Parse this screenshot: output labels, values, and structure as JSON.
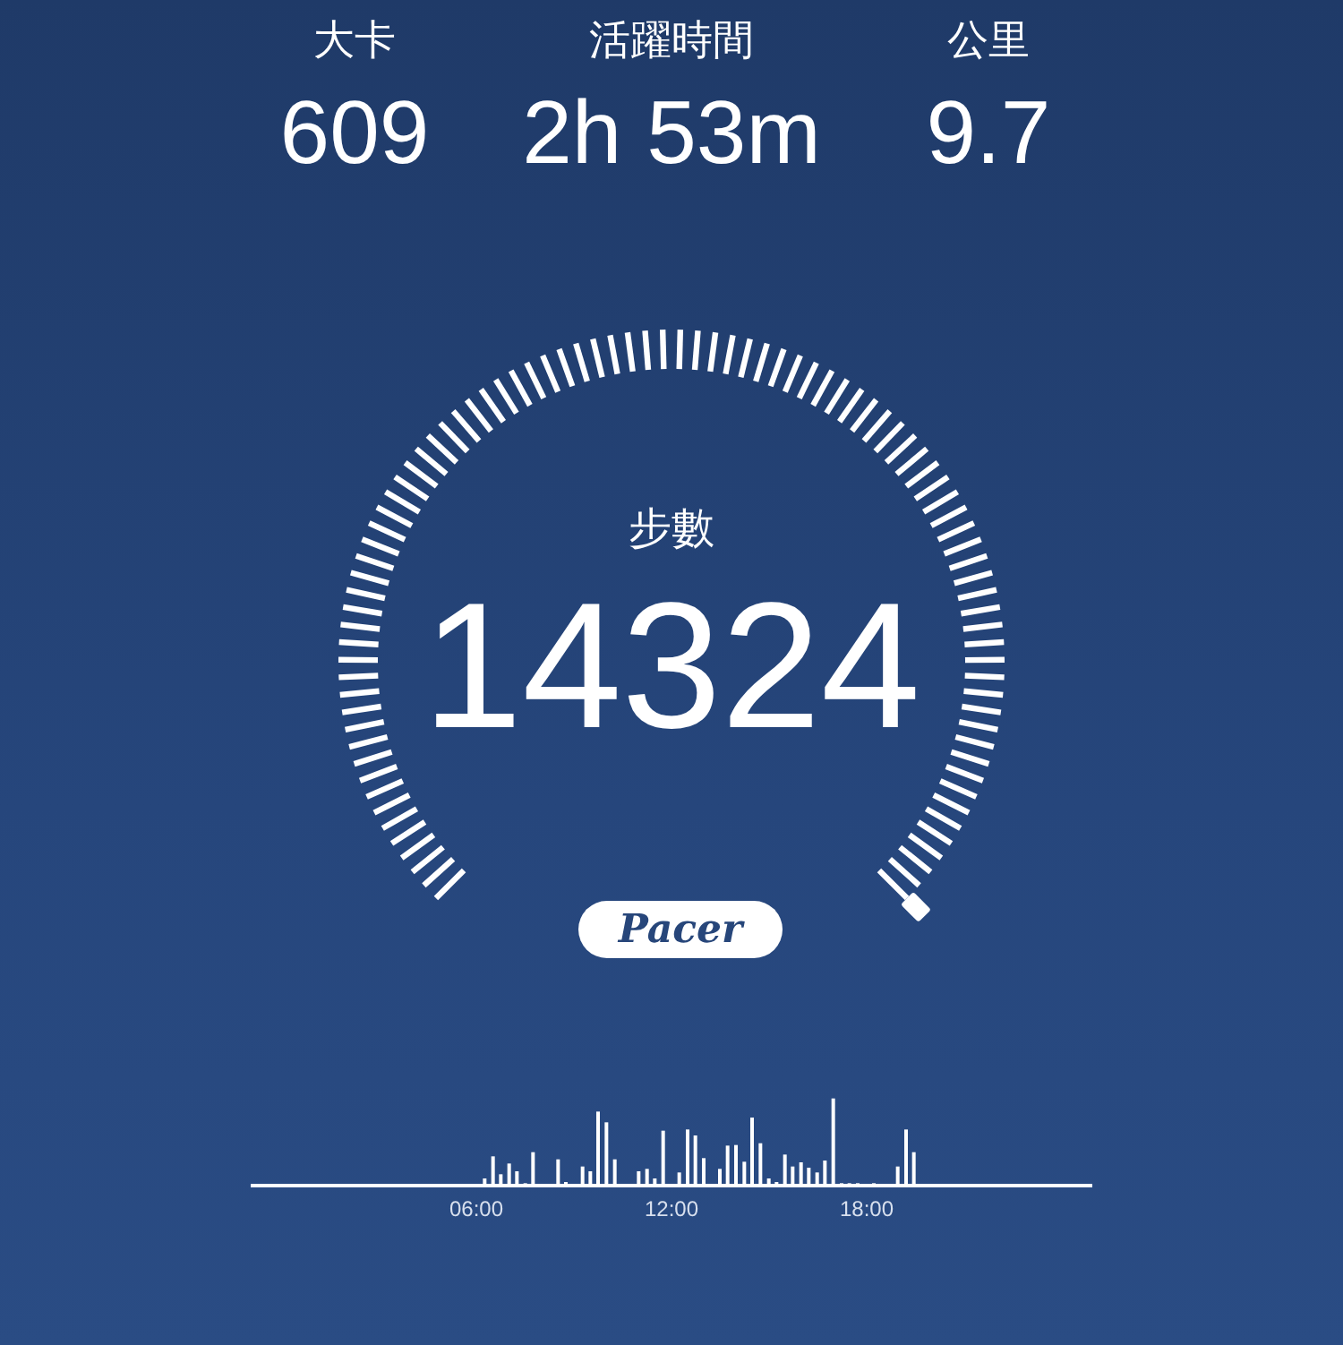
{
  "stats": [
    {
      "label": "大卡",
      "value": "609"
    },
    {
      "label": "活躍時間",
      "value": "2h 53m"
    },
    {
      "label": "公里",
      "value": "9.7"
    }
  ],
  "gauge": {
    "label": "步數",
    "value": "14324"
  },
  "logo": {
    "text": "Pacer"
  },
  "timeline": {
    "x_labels": [
      "06:00",
      "12:00",
      "18:00"
    ]
  }
}
